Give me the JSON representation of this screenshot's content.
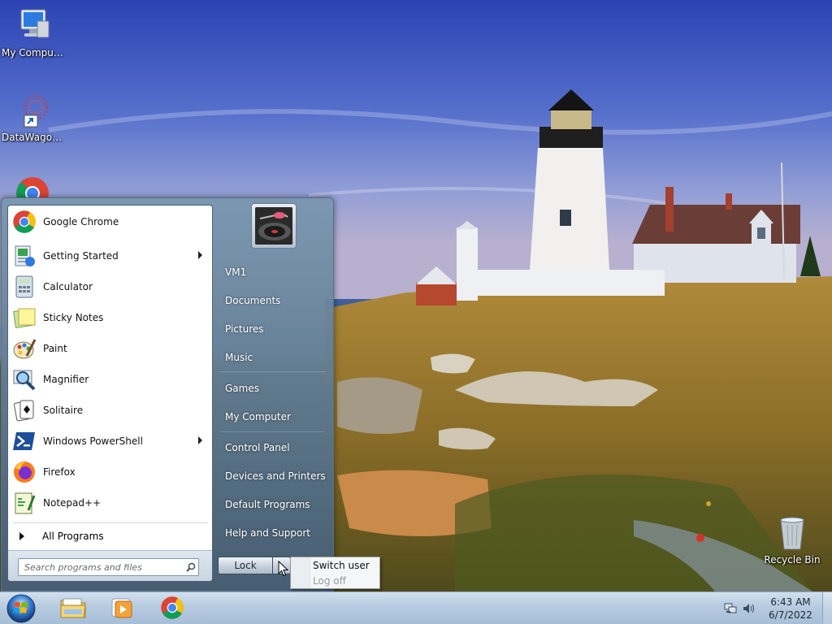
{
  "desktop": {
    "icons": [
      {
        "label": "My Computer",
        "icon": "computer-icon"
      },
      {
        "label": "DataWagon...",
        "icon": "datawagon-shortcut-icon"
      },
      {
        "label": "",
        "icon": "chrome-icon"
      },
      {
        "label": "Recycle Bin",
        "icon": "recycle-bin-icon"
      }
    ]
  },
  "start_menu": {
    "programs": [
      {
        "label": "Google Chrome",
        "icon": "chrome-icon",
        "has_submenu": false
      },
      {
        "label": "Getting Started",
        "icon": "getting-started-icon",
        "has_submenu": true
      },
      {
        "label": "Calculator",
        "icon": "calculator-icon",
        "has_submenu": false
      },
      {
        "label": "Sticky Notes",
        "icon": "sticky-notes-icon",
        "has_submenu": false
      },
      {
        "label": "Paint",
        "icon": "paint-icon",
        "has_submenu": false
      },
      {
        "label": "Magnifier",
        "icon": "magnifier-icon",
        "has_submenu": false
      },
      {
        "label": "Solitaire",
        "icon": "solitaire-icon",
        "has_submenu": false
      },
      {
        "label": "Windows PowerShell",
        "icon": "powershell-icon",
        "has_submenu": true
      },
      {
        "label": "Firefox",
        "icon": "firefox-icon",
        "has_submenu": false
      },
      {
        "label": "Notepad++",
        "icon": "notepadpp-icon",
        "has_submenu": false
      }
    ],
    "all_programs": "All Programs",
    "search_placeholder": "Search programs and files",
    "right_items": [
      "VM1",
      "Documents",
      "Pictures",
      "Music",
      "Games",
      "My Computer",
      "Control Panel",
      "Devices and Printers",
      "Default Programs",
      "Help and Support"
    ],
    "lock_label": "Lock",
    "power_menu": {
      "items": [
        {
          "label": "Switch user",
          "enabled": true
        },
        {
          "label": "Log off",
          "enabled": false
        }
      ]
    }
  },
  "taskbar": {
    "pinned": [
      "explorer-icon",
      "media-player-icon",
      "chrome-icon"
    ],
    "tray": [
      "network-icon",
      "volume-icon"
    ],
    "clock": {
      "time": "6:43 AM",
      "date": "6/7/2022"
    }
  }
}
